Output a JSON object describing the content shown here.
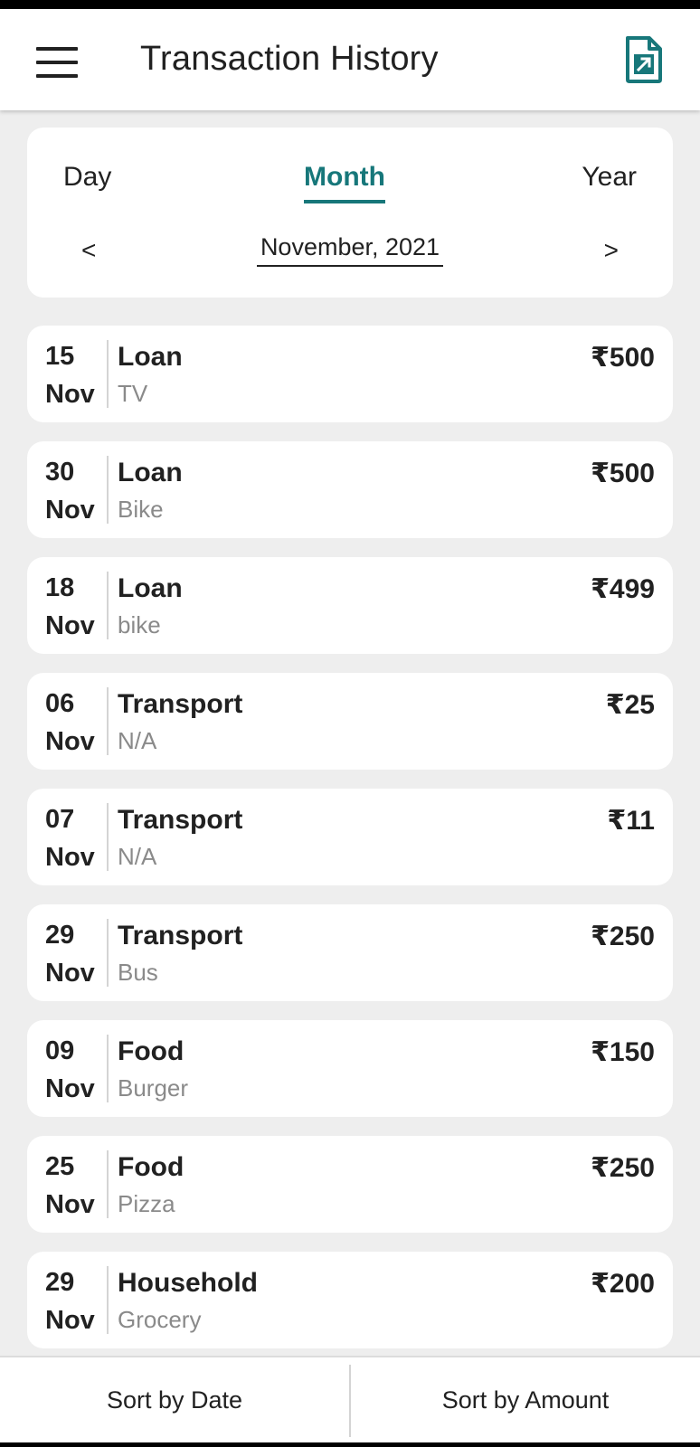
{
  "header": {
    "title": "Transaction History",
    "menu_icon": "hamburger-menu-icon",
    "export_icon": "file-export-icon",
    "accent_color": "#17777a"
  },
  "filter": {
    "tabs": [
      "Day",
      "Month",
      "Year"
    ],
    "selected_tab": "Month",
    "prev_label": "<",
    "next_label": ">",
    "period": "November, 2021"
  },
  "transactions": [
    {
      "day": "15",
      "month": "Nov",
      "category": "Loan",
      "note": "TV",
      "amount": "₹500"
    },
    {
      "day": "30",
      "month": "Nov",
      "category": "Loan",
      "note": "Bike",
      "amount": "₹500"
    },
    {
      "day": "18",
      "month": "Nov",
      "category": "Loan",
      "note": "bike",
      "amount": "₹499"
    },
    {
      "day": "06",
      "month": "Nov",
      "category": "Transport",
      "note": "N/A",
      "amount": "₹25"
    },
    {
      "day": "07",
      "month": "Nov",
      "category": "Transport",
      "note": "N/A",
      "amount": "₹11"
    },
    {
      "day": "29",
      "month": "Nov",
      "category": "Transport",
      "note": "Bus",
      "amount": "₹250"
    },
    {
      "day": "09",
      "month": "Nov",
      "category": "Food",
      "note": "Burger",
      "amount": "₹150"
    },
    {
      "day": "25",
      "month": "Nov",
      "category": "Food",
      "note": "Pizza",
      "amount": "₹250"
    },
    {
      "day": "29",
      "month": "Nov",
      "category": "Household",
      "note": "Grocery",
      "amount": "₹200"
    }
  ],
  "bottom_bar": {
    "sort_date": "Sort by Date",
    "sort_amount": "Sort by Amount"
  }
}
